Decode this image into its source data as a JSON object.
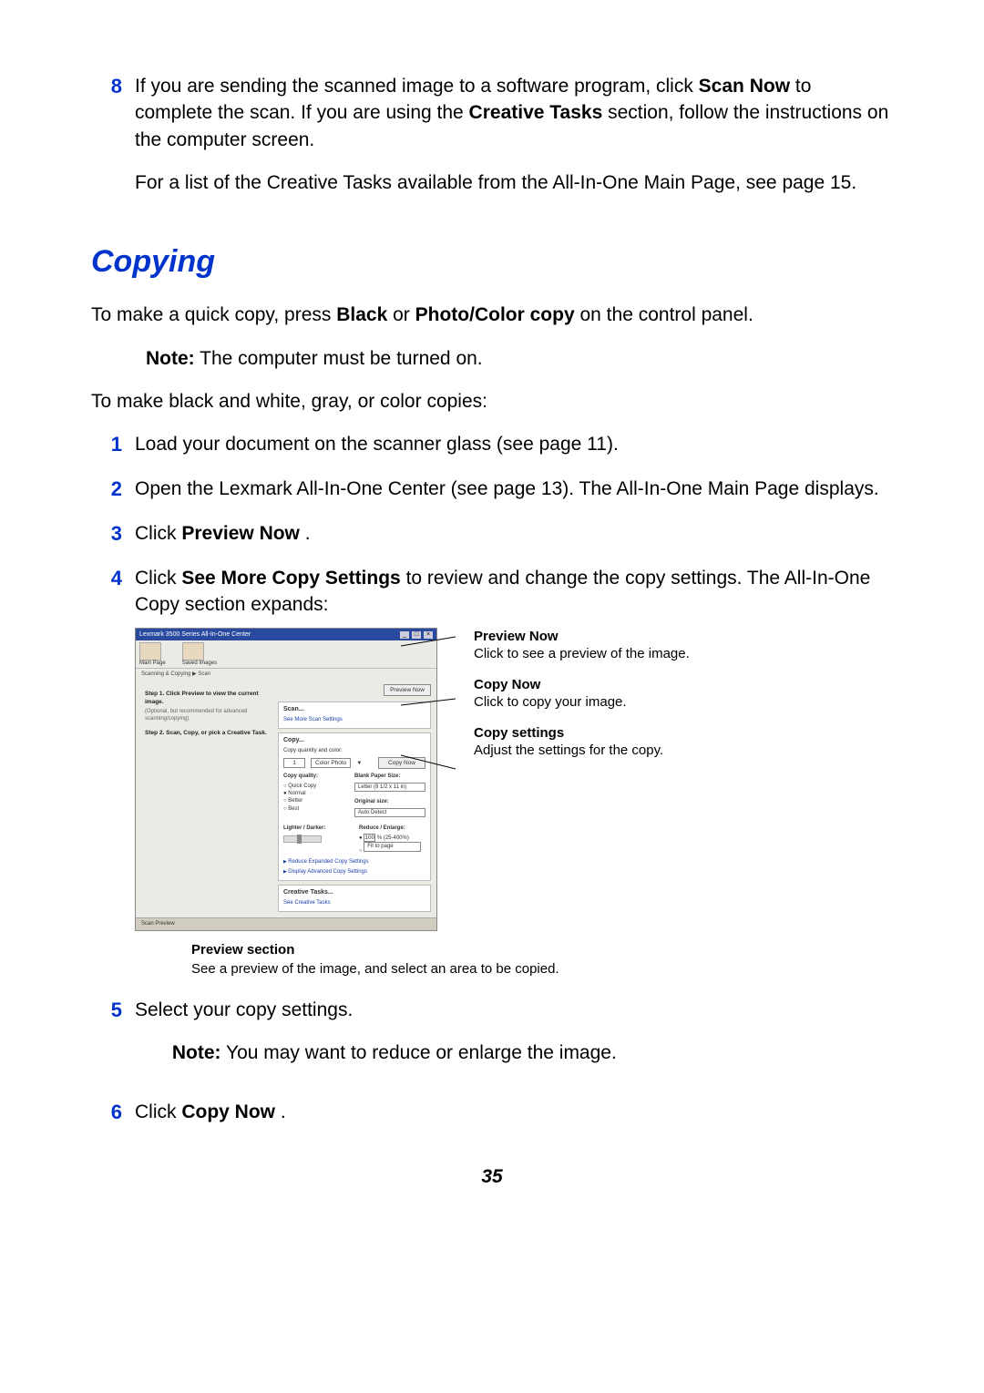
{
  "page_number": "35",
  "step8": {
    "num": "8",
    "text_a": "If you are sending the scanned image to a software program, click ",
    "scan_now": "Scan Now",
    "text_b": " to complete the scan. If you are using the ",
    "creative_tasks": "Creative Tasks",
    "text_c": " section, follow the instructions on the computer screen.",
    "text_d": "For a list of the Creative Tasks available from the All-In-One Main Page, see page 15."
  },
  "heading": "Copying",
  "intro_a": "To make a quick copy, press ",
  "intro_bold_a": "Black",
  "intro_b": " or ",
  "intro_bold_b": "Photo/Color copy",
  "intro_c": " on the control panel.",
  "note1_label": "Note:",
  "note1_text": " The computer must be turned on.",
  "intro2": "To make black and white, gray, or color copies:",
  "steps": {
    "s1": {
      "num": "1",
      "text": "Load your document on the scanner glass (see page 11)."
    },
    "s2": {
      "num": "2",
      "text": "Open the Lexmark All-In-One Center (see page 13). The All-In-One Main Page displays."
    },
    "s3": {
      "num": "3",
      "text_a": "Click ",
      "bold": "Preview Now",
      "text_b": "."
    },
    "s4": {
      "num": "4",
      "text_a": "Click ",
      "bold": "See More Copy Settings",
      "text_b": " to review and change the copy settings. The All-In-One Copy section expands:"
    },
    "s5": {
      "num": "5",
      "text": "Select your copy settings.",
      "note_label": "Note:",
      "note_text": " You may want to reduce or enlarge the image."
    },
    "s6": {
      "num": "6",
      "text_a": "Click ",
      "bold": "Copy Now",
      "text_b": "."
    }
  },
  "window": {
    "title": "Lexmark 3500 Series All-In-One Center",
    "tabs": {
      "main": "Main Page",
      "saved": "Saved Images"
    },
    "breadcrumb": "Scanning & Copying  ▶  Scan",
    "preview_now_btn": "Preview Now",
    "left": {
      "step1_hd": "Step 1.  Click Preview to view the current image.",
      "step1_sub": "(Optional, but recommended for advanced scanning/copying)",
      "step2_hd": "Step 2.  Scan, Copy, or pick a Creative Task."
    },
    "scan": {
      "hd": "Scan...",
      "link": "See More Scan Settings"
    },
    "copy": {
      "hd": "Copy...",
      "sub": "Copy quantity and color:",
      "qty": "1",
      "mode": "Color Photo",
      "btn": "Copy Now",
      "quality_hd": "Copy quality:",
      "quality_opts": [
        "Quick Copy",
        "Normal",
        "Better",
        "Best"
      ],
      "quality_sel": "Normal",
      "paper_hd": "Blank Paper Size:",
      "paper_val": "Letter (8 1/2 x 11 in)",
      "orig_hd": "Original size:",
      "orig_val": "Auto Detect",
      "lighter_hd": "Lighter / Darker:",
      "reduce_hd": "Reduce / Enlarge:",
      "reduce_pct": "100",
      "reduce_pct_label": "% (25-400%)",
      "reduce_fit": "Fit to page",
      "links": [
        "Reduce Expanded Copy Settings",
        "Display Advanced Copy Settings"
      ]
    },
    "creative": {
      "hd": "Creative Tasks...",
      "link": "See Creative Tasks"
    },
    "footer": "Scan Preview"
  },
  "callouts": {
    "preview_now": {
      "hd": "Preview Now",
      "bd": "Click to see a preview of the image."
    },
    "copy_now": {
      "hd": "Copy Now",
      "bd": "Click to copy your image."
    },
    "copy_settings": {
      "hd": "Copy settings",
      "bd": "Adjust the settings for the copy."
    },
    "preview_section": {
      "hd": "Preview section",
      "bd": "See a preview of the image, and select an area to be copied."
    }
  }
}
